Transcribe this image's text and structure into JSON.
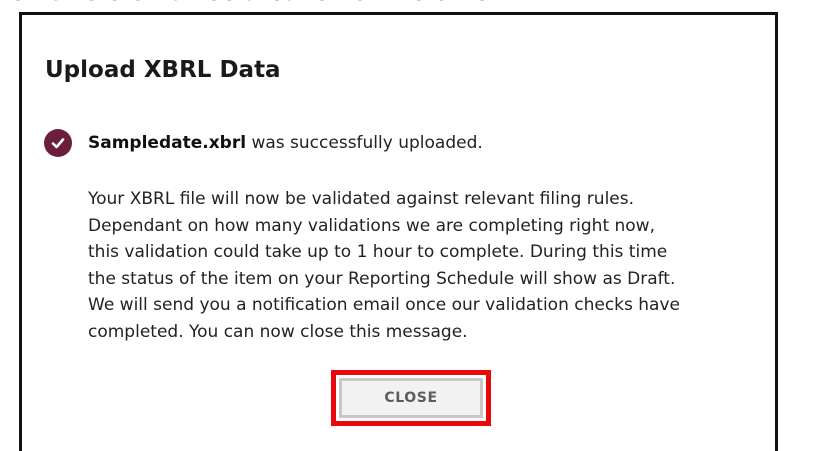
{
  "top_strip": {
    "text": "ethat ets ethanise ateane net the ethe"
  },
  "modal": {
    "title": "Upload XBRL Data",
    "status": {
      "filename": "Sampledate.xbrl",
      "message": " was successfully uploaded.",
      "icon": "checkmark-circle-icon",
      "icon_color": "#6b1f3d"
    },
    "body_lines": [
      "Your XBRL file will now be validated against relevant filing rules.",
      "Dependant on how many validations we are completing right now,",
      "this validation could take up to 1 hour to complete. During this time",
      "the status of the item on your Reporting Schedule will show as Draft.",
      "We will send you a notification email once our validation checks have",
      "completed. You can now close this message."
    ],
    "close_label": "CLOSE",
    "highlight_color": "#e8090d"
  }
}
